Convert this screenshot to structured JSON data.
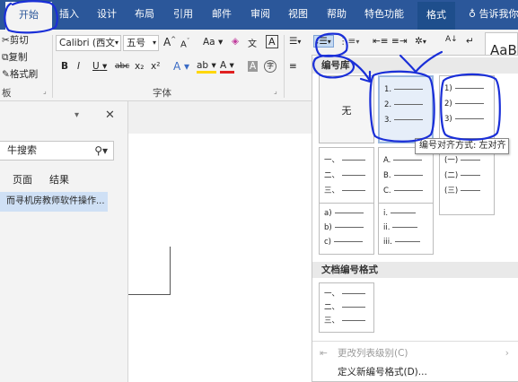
{
  "tabs": {
    "file": "",
    "home": "开始",
    "insert": "插入",
    "design": "设计",
    "layout": "布局",
    "references": "引用",
    "mailings": "邮件",
    "review": "审阅",
    "view": "视图",
    "help": "帮助",
    "special": "特色功能",
    "format": "格式",
    "tell_me": "告诉我你"
  },
  "clipboard": {
    "cut": "剪切",
    "copy": "复制",
    "format_painter": "格式刷",
    "group_label": "板"
  },
  "font": {
    "font_name": "Calibri (西文",
    "font_size": "五号",
    "grow": "A",
    "shrink": "A",
    "change_case": "Aa",
    "clear": "A",
    "pinyin": "文",
    "border": "A",
    "bold": "B",
    "italic": "I",
    "underline": "U",
    "strike": "abc",
    "subscript": "x₂",
    "superscript": "x²",
    "effects": "A",
    "highlight": "ab",
    "color": "A",
    "shading": "A",
    "enclose": "字",
    "group_label": "字体"
  },
  "paragraph": {
    "sort": "A↓",
    "marks": "↵"
  },
  "styles": {
    "preview": "AaB"
  },
  "nav": {
    "search_placeholder": "牛搜索",
    "tab_pages": "页面",
    "tab_results": "结果",
    "selected_heading": "而寻机房教师软件操作..."
  },
  "dropdown": {
    "library_header": "编号库",
    "none_label": "无",
    "doc_formats_header": "文档编号格式",
    "change_level": "更改列表级别(C)",
    "define_new": "定义新编号格式(D)...",
    "tooltip": "编号对齐方式: 左对齐",
    "formats": [
      [
        "1.",
        "2.",
        "3."
      ],
      [
        "1)",
        "2)",
        "3)"
      ],
      [
        "一、",
        "二、",
        "三、"
      ],
      [
        "A.",
        "B.",
        "C."
      ],
      [
        "(一)",
        "(二)",
        "(三)"
      ],
      [
        "a)",
        "b)",
        "c)"
      ],
      [
        "i.",
        "ii.",
        "iii."
      ],
      [
        "一、",
        "二、",
        "三、"
      ]
    ]
  },
  "colors": {
    "ribbon_blue": "#2b579a",
    "pen_blue": "#1a2fd8",
    "highlight_yellow": "#ffd700",
    "font_red": "#e02020"
  }
}
